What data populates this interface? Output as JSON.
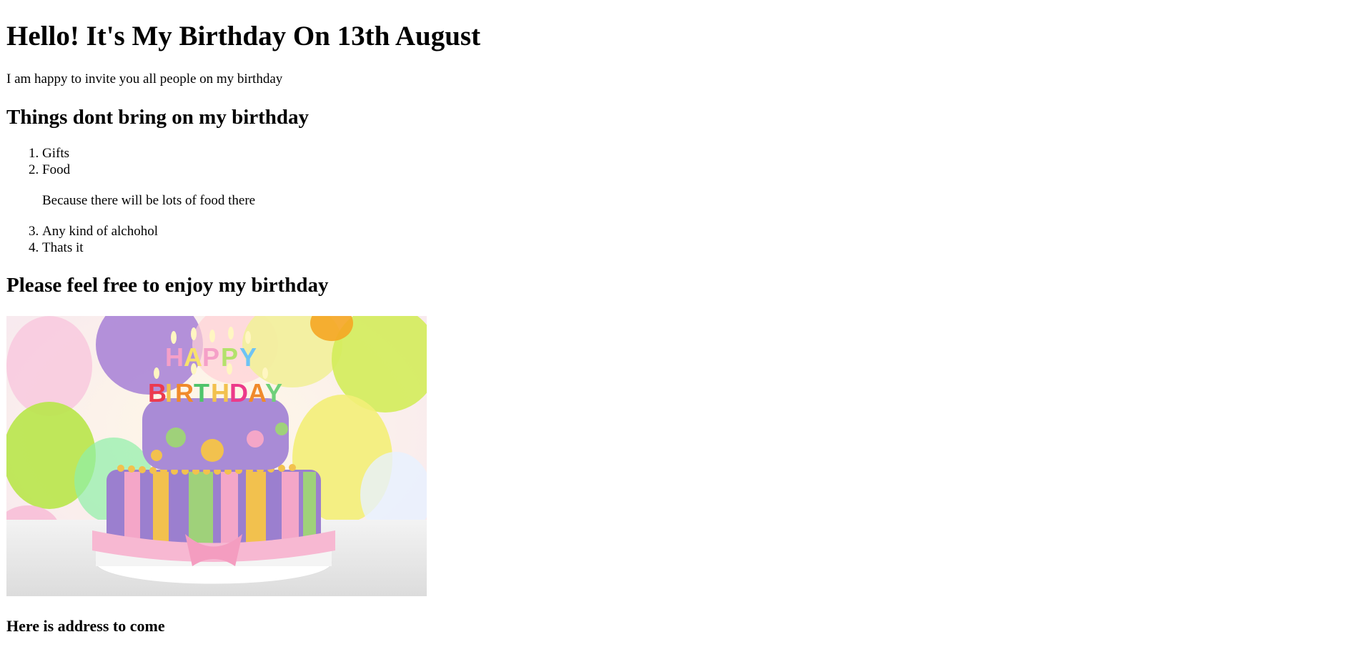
{
  "heading": "Hello! It's My Birthday On 13th August",
  "intro": "I am happy to invite you all people on my birthday",
  "things_heading": "Things dont bring on my birthday",
  "list": {
    "item1": "Gifts",
    "item2": "Food",
    "item2_note": "Because there will be lots of food there",
    "item3": "Any kind of alchohol",
    "item4": "Thats it"
  },
  "enjoy_heading": "Please feel free to enjoy my birthday",
  "cake_image": {
    "icon": "birthday-cake-photo",
    "alt": "HAPPY BIRTHDAY",
    "candle_text_top": "HAPPY",
    "candle_text_bottom": "BIRTHDAY"
  },
  "address_heading": "Here is address to come"
}
